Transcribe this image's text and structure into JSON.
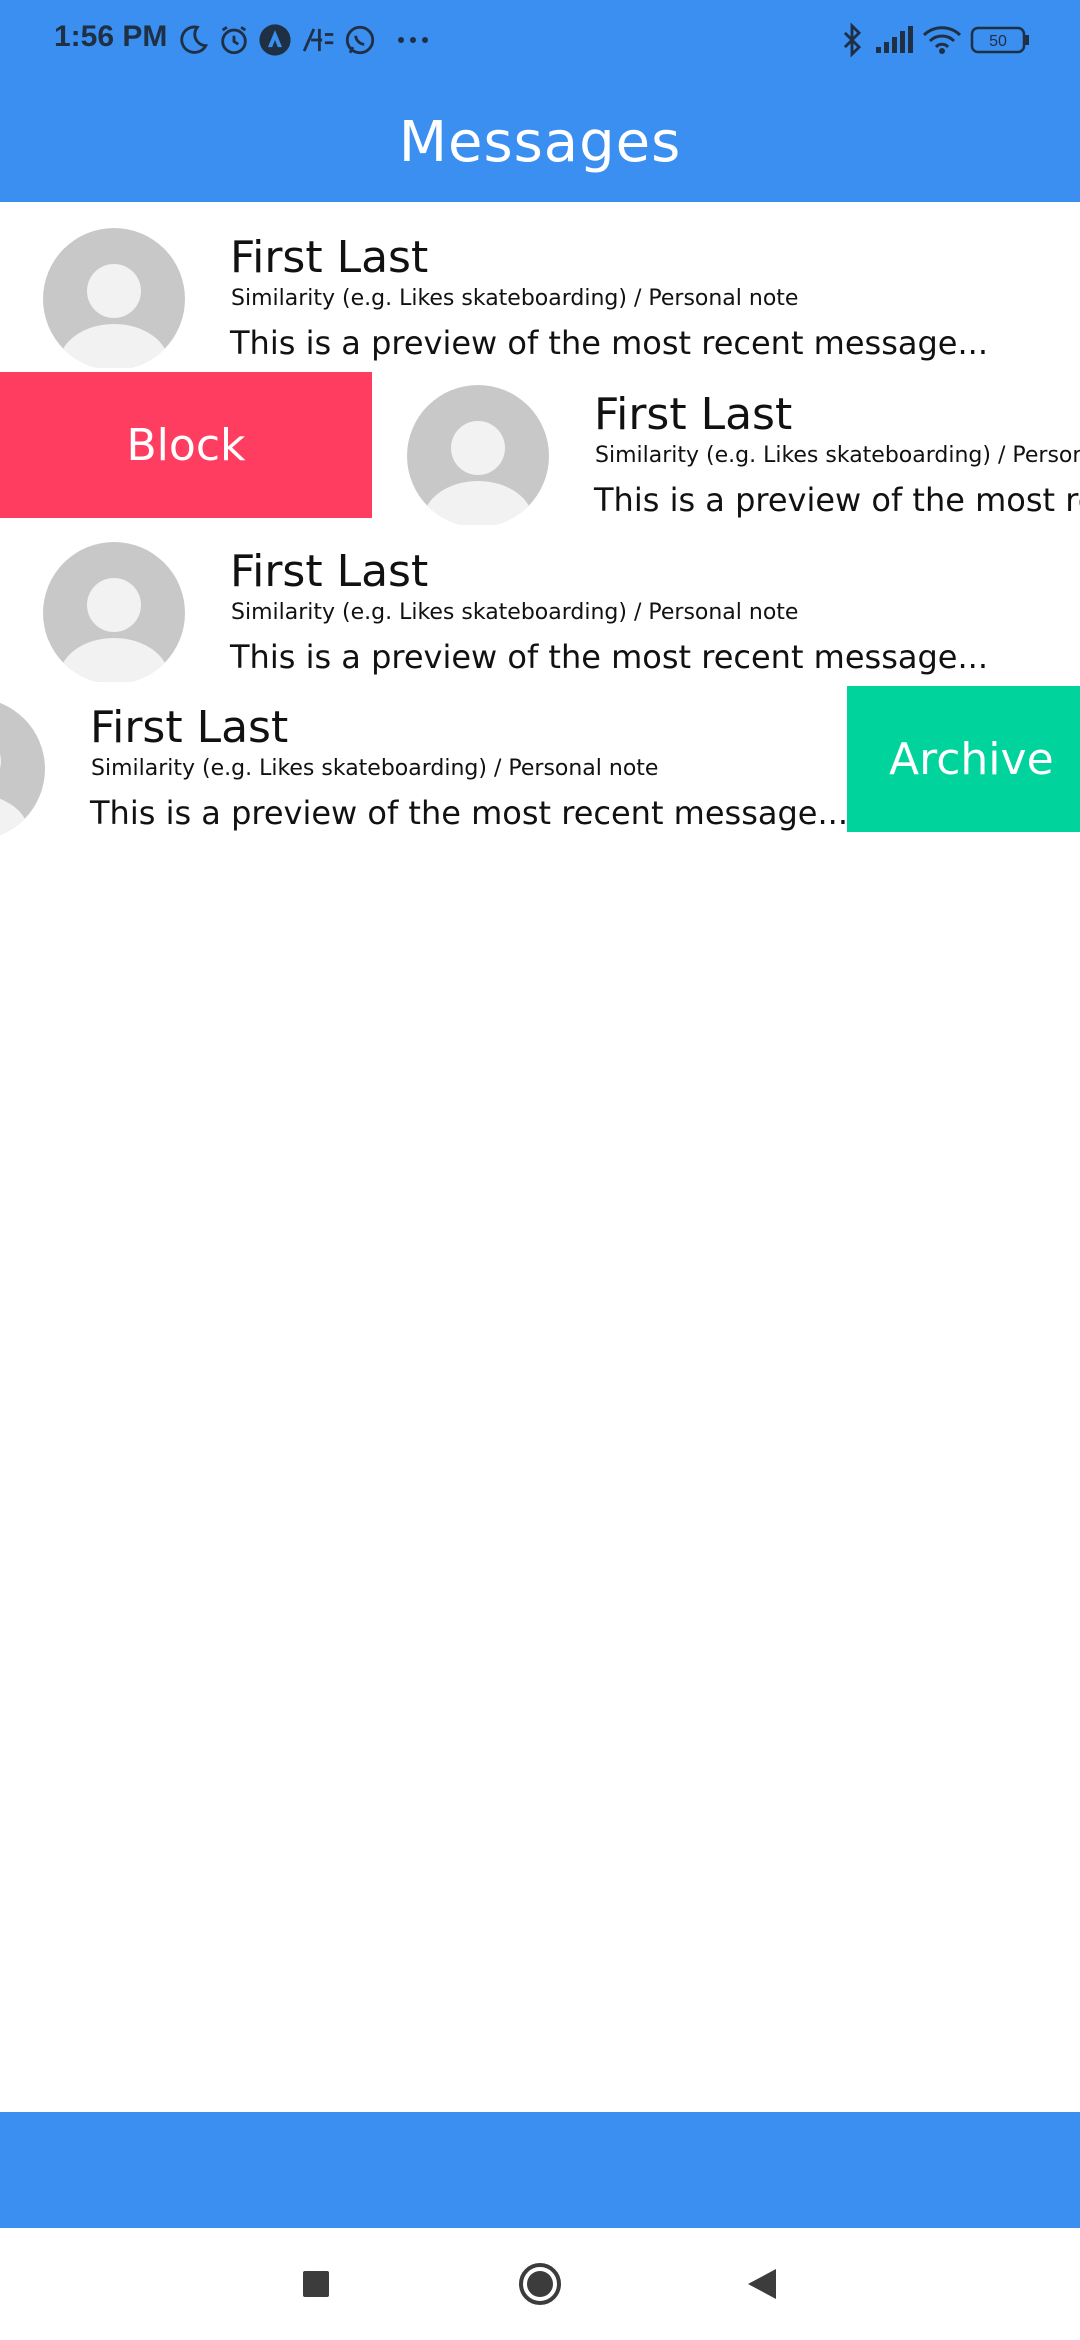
{
  "status_bar": {
    "time": "1:56 PM",
    "battery": "50",
    "icons": [
      "moon-icon",
      "alarm-icon",
      "nav-app-icon",
      "notification-icon",
      "whatsapp-icon",
      "more-dots-icon",
      "bluetooth-icon",
      "signal-icon",
      "wifi-icon",
      "battery-icon"
    ]
  },
  "header": {
    "title": "Messages"
  },
  "messages": [
    {
      "name": "First Last",
      "similarity": "Similarity (e.g. Likes skateboarding) / Personal note",
      "preview": "This is a preview of the most recent message..."
    },
    {
      "name": "First Last",
      "similarity": "Similarity (e.g. Likes skateboarding) / Personal note",
      "preview": "This is a preview of the most recent message..."
    },
    {
      "name": "First Last",
      "similarity": "Similarity (e.g. Likes skateboarding) / Personal note",
      "preview": "This is a preview of the most recent message..."
    },
    {
      "name": "First Last",
      "similarity": "Similarity (e.g. Likes skateboarding) / Personal note",
      "preview": "This is a preview of the most recent message..."
    }
  ],
  "actions": {
    "block_label": "Block",
    "archive_label": "Archive"
  },
  "colors": {
    "primary": "#3a8ff0",
    "block": "#ff3d60",
    "archive": "#00d39b"
  },
  "nav_bar": {
    "icons": [
      "recents-square-icon",
      "home-circle-icon",
      "back-triangle-icon"
    ]
  }
}
